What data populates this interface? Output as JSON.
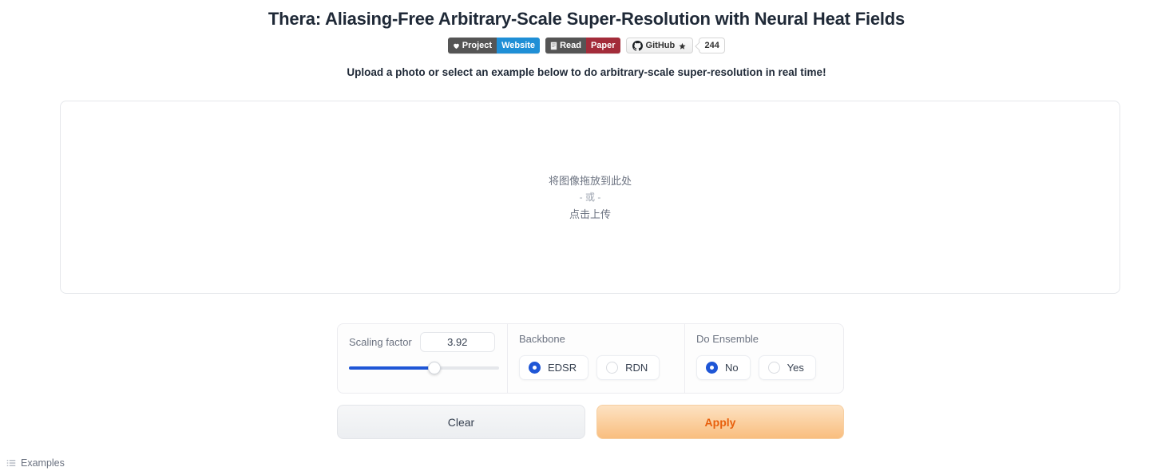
{
  "header": {
    "title": "Thera: Aliasing-Free Arbitrary-Scale Super-Resolution with Neural Heat Fields",
    "subtitle": "Upload a photo or select an example below to do arbitrary-scale super-resolution in real time!"
  },
  "badges": {
    "project": {
      "icon": "heart-icon",
      "left_label": "Project",
      "right_label": "Website",
      "left_color": "#555555",
      "right_color": "#1f8fd6"
    },
    "paper": {
      "icon": "document-icon",
      "left_label": "Read",
      "right_label": "Paper",
      "left_color": "#555555",
      "right_color": "#a32c3a"
    },
    "github": {
      "icon": "github-icon",
      "label": "GitHub",
      "star_icon": "star-icon",
      "star_count": "244"
    }
  },
  "dropzone": {
    "drag_text": "将图像拖放到此处",
    "or_text": "- 或 -",
    "click_text": "点击上传"
  },
  "controls": {
    "scaling": {
      "label": "Scaling factor",
      "value": "3.92",
      "slider_percent": 57,
      "fill_color": "#1f56d6"
    },
    "backbone": {
      "label": "Backbone",
      "options": [
        {
          "label": "EDSR",
          "selected": true
        },
        {
          "label": "RDN",
          "selected": false
        }
      ]
    },
    "ensemble": {
      "label": "Do Ensemble",
      "options": [
        {
          "label": "No",
          "selected": true
        },
        {
          "label": "Yes",
          "selected": false
        }
      ]
    }
  },
  "actions": {
    "clear_label": "Clear",
    "apply_label": "Apply",
    "apply_text_color": "#e8600d"
  },
  "footer": {
    "examples_icon": "list-icon",
    "examples_label": "Examples"
  }
}
